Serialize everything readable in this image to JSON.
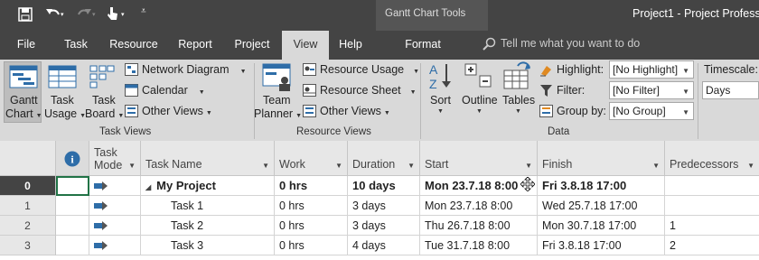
{
  "window": {
    "title": "Project1  -  Project Professi",
    "context_tools_label": "Gantt Chart Tools"
  },
  "quick_access": {
    "save_icon": "save-icon",
    "undo_icon": "undo-icon",
    "redo_icon": "redo-icon",
    "touch_icon": "touch-mode-icon",
    "customize_icon": "customize-qat-icon"
  },
  "tabs": [
    {
      "label": "File"
    },
    {
      "label": "Task"
    },
    {
      "label": "Resource"
    },
    {
      "label": "Report"
    },
    {
      "label": "Project"
    },
    {
      "label": "View",
      "active": true
    },
    {
      "label": "Help"
    },
    {
      "label": "Format"
    }
  ],
  "tell_me": {
    "placeholder": "Tell me what you want to do"
  },
  "ribbon": {
    "task_views": {
      "group_label": "Task Views",
      "gantt": {
        "line1": "Gantt",
        "line2": "Chart"
      },
      "task_usage": {
        "line1": "Task",
        "line2": "Usage"
      },
      "task_board": {
        "line1": "Task",
        "line2": "Board"
      },
      "network_diagram": "Network Diagram",
      "calendar": "Calendar",
      "other_views": "Other Views"
    },
    "resource_views": {
      "group_label": "Resource Views",
      "team_planner": {
        "line1": "Team",
        "line2": "Planner"
      },
      "resource_usage": "Resource Usage",
      "resource_sheet": "Resource Sheet",
      "other_views": "Other Views"
    },
    "data": {
      "group_label": "Data",
      "sort": "Sort",
      "outline": "Outline",
      "tables": "Tables",
      "highlight_label": "Highlight:",
      "highlight_value": "[No Highlight]",
      "filter_label": "Filter:",
      "filter_value": "[No Filter]",
      "groupby_label": "Group by:",
      "groupby_value": "[No Group]"
    },
    "zoom": {
      "timescale_label": "Timescale:",
      "timescale_value": "Days"
    }
  },
  "table": {
    "columns": {
      "info": "i",
      "mode": {
        "line1": "Task",
        "line2": "Mode"
      },
      "name": "Task Name",
      "work": "Work",
      "duration": "Duration",
      "start": "Start",
      "finish": "Finish",
      "predecessors": "Predecessors"
    },
    "rows": [
      {
        "id": "0",
        "name": "My Project",
        "work": "0 hrs",
        "duration": "10 days",
        "start": "Mon 23.7.18 8:00",
        "finish": "Fri 3.8.18 17:00",
        "predecessors": "",
        "summary": true
      },
      {
        "id": "1",
        "name": "Task 1",
        "work": "0 hrs",
        "duration": "3 days",
        "start": "Mon 23.7.18 8:00",
        "finish": "Wed 25.7.18 17:00",
        "predecessors": ""
      },
      {
        "id": "2",
        "name": "Task 2",
        "work": "0 hrs",
        "duration": "3 days",
        "start": "Thu 26.7.18 8:00",
        "finish": "Mon 30.7.18 17:00",
        "predecessors": "1"
      },
      {
        "id": "3",
        "name": "Task 3",
        "work": "0 hrs",
        "duration": "4 days",
        "start": "Tue 31.7.18 8:00",
        "finish": "Fri 3.8.18 17:00",
        "predecessors": "2"
      }
    ]
  }
}
